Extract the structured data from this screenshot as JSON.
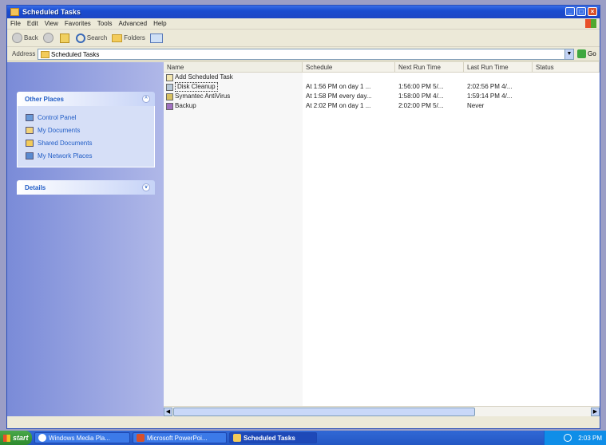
{
  "window": {
    "title": "Scheduled Tasks"
  },
  "menu": [
    "File",
    "Edit",
    "View",
    "Favorites",
    "Tools",
    "Advanced",
    "Help"
  ],
  "toolbar": {
    "back": "Back",
    "search": "Search",
    "folders": "Folders"
  },
  "address": {
    "label": "Address",
    "value": "Scheduled Tasks",
    "go": "Go"
  },
  "taskpane": {
    "other_places": {
      "title": "Other Places",
      "items": [
        "Control Panel",
        "My Documents",
        "Shared Documents",
        "My Network Places"
      ]
    },
    "details": {
      "title": "Details"
    }
  },
  "columns": [
    "Name",
    "Schedule",
    "Next Run Time",
    "Last Run Time",
    "Status"
  ],
  "rows": [
    {
      "name": "Add Scheduled Task",
      "schedule": "",
      "next": "",
      "last": ""
    },
    {
      "name": "Disk Cleanup",
      "schedule": "At 1:56 PM on day 1 ...",
      "next": "1:56:00 PM 5/...",
      "last": "2:02:56 PM 4/..."
    },
    {
      "name": "Symantec AntiVirus",
      "schedule": "At 1:58 PM every day...",
      "next": "1:58:00 PM 4/...",
      "last": "1:59:14 PM 4/..."
    },
    {
      "name": "Backup",
      "schedule": "At 2:02 PM on day 1 ...",
      "next": "2:02:00 PM 5/...",
      "last": "Never"
    }
  ],
  "taskbar": {
    "start": "start",
    "tasks": [
      "Windows Media Pla...",
      "Microsoft PowerPoi...",
      "Scheduled Tasks"
    ],
    "clock": "2:03 PM"
  }
}
